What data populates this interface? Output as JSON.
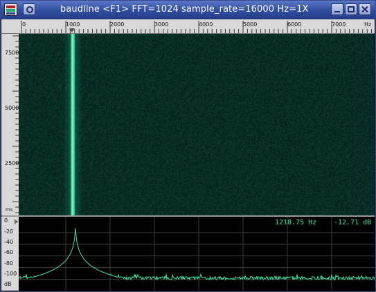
{
  "window": {
    "title": "baudline  <F1> FFT=1024 sample_rate=16000 Hz=1X"
  },
  "ruler": {
    "labels": [
      "0",
      "1000",
      "2000",
      "3000",
      "4000",
      "5000",
      "6000",
      "7000",
      "Hz"
    ]
  },
  "time_axis": {
    "labels": [
      "7500",
      "5000",
      "2500"
    ],
    "unit": "ms"
  },
  "db_axis": {
    "labels": [
      "0",
      "-20",
      "-40",
      "-60",
      "-80",
      "-100",
      "dB"
    ]
  },
  "readout": {
    "frequency": "1218.75 Hz",
    "level": "-12.71 dB"
  },
  "colors": {
    "trace": "#3fe3a0",
    "background": "#05231c"
  },
  "chart_data": {
    "type": "line",
    "x_unit": "Hz",
    "y_unit": "dB",
    "xlim": [
      0,
      8000
    ],
    "ylim": [
      -110,
      0
    ],
    "peak": {
      "x": 1218.75,
      "y": -12.71
    },
    "noise_floor": -98
  }
}
